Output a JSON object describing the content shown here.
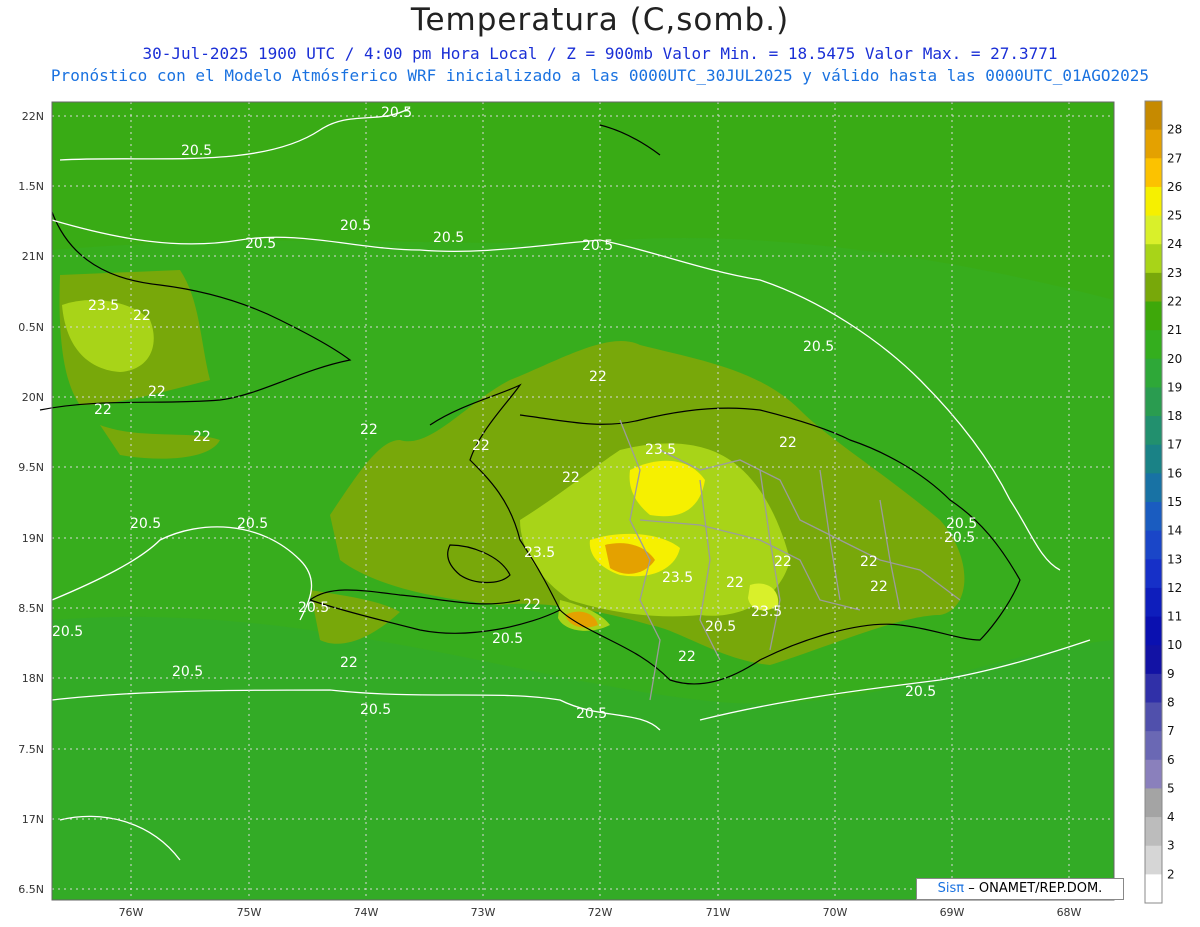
{
  "header": {
    "title": "Temperatura (C,somb.)",
    "line1": "30-Jul-2025   1900 UTC / 4:00 pm Hora Local / Z = 900mb     Valor Min. = 18.5475  Valor Max. = 27.3771",
    "line2": "Pronóstico con el Modelo Atmósferico WRF inicializado a las 0000UTC_30JUL2025 y válido hasta las  0000UTC_01AGO2025"
  },
  "axes": {
    "lat_labels": [
      "22N",
      "1.5N",
      "21N",
      "0.5N",
      "20N",
      "9.5N",
      "19N",
      "8.5N",
      "18N",
      "7.5N",
      "17N",
      "6.5N"
    ],
    "lon_labels": [
      "76W",
      "75W",
      "74W",
      "73W",
      "72W",
      "71W",
      "70W",
      "69W",
      "68W"
    ]
  },
  "contour_labels": [
    "20.5",
    "22",
    "23.5"
  ],
  "colorbar": {
    "labels": [
      "28",
      "27",
      "26",
      "25",
      "24",
      "23",
      "22",
      "21",
      "20",
      "19",
      "18",
      "17",
      "16",
      "15",
      "14",
      "13",
      "12",
      "11",
      "10",
      "9",
      "8",
      "7",
      "6",
      "5",
      "4",
      "3",
      "2"
    ],
    "colors": [
      "#c68a00",
      "#e4a100",
      "#fcc200",
      "#f6f000",
      "#d9f02a",
      "#a8d418",
      "#78a80a",
      "#3ea80a",
      "#34ae1e",
      "#2ea838",
      "#2a9c50",
      "#22906e",
      "#1a8286",
      "#1872a4",
      "#1a5cc0",
      "#1a46c8",
      "#1630c8",
      "#0e1ebc",
      "#0a10b0",
      "#1212a4",
      "#3030a8",
      "#5050ac",
      "#6a68b4",
      "#8a80bc",
      "#a4a4a4",
      "#bcbcbc",
      "#d6d6d6",
      "#ffffff"
    ]
  },
  "credit": {
    "logo": "Sisπ",
    "text": "– ONAMET/REP.DOM."
  }
}
